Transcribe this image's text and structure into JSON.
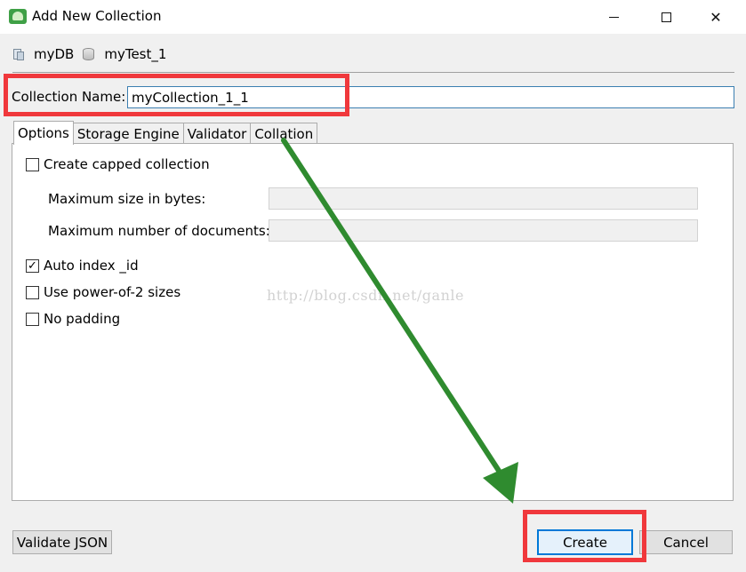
{
  "window": {
    "title": "Add New Collection",
    "icon": "app-leaf-icon",
    "controls": [
      "minimize-icon",
      "maximize-icon",
      "close-icon"
    ]
  },
  "breadcrumb": {
    "database": "myDB",
    "collection": "myTest_1"
  },
  "collection_name": {
    "label": "Collection Name:",
    "value": "myCollection_1_1"
  },
  "tabs": [
    {
      "label": "Options",
      "active": true
    },
    {
      "label": "Storage Engine",
      "active": false
    },
    {
      "label": "Validator",
      "active": false
    },
    {
      "label": "Collation",
      "active": false
    }
  ],
  "options": {
    "capped": {
      "label": "Create capped collection",
      "checked": false
    },
    "max_size_label": "Maximum size in bytes:",
    "max_docs_label": "Maximum number of documents:",
    "auto_index": {
      "label": "Auto index _id",
      "checked": true
    },
    "power_of_2": {
      "label": "Use power-of-2 sizes",
      "checked": false
    },
    "no_padding": {
      "label": "No padding",
      "checked": false
    }
  },
  "watermark": "http://blog.csdn.net/ganle",
  "buttons": {
    "validate": "Validate JSON",
    "create": "Create",
    "cancel": "Cancel"
  },
  "colors": {
    "highlight": "#f0383c",
    "arrow": "#2f8b2f",
    "focus": "#0078d7"
  }
}
